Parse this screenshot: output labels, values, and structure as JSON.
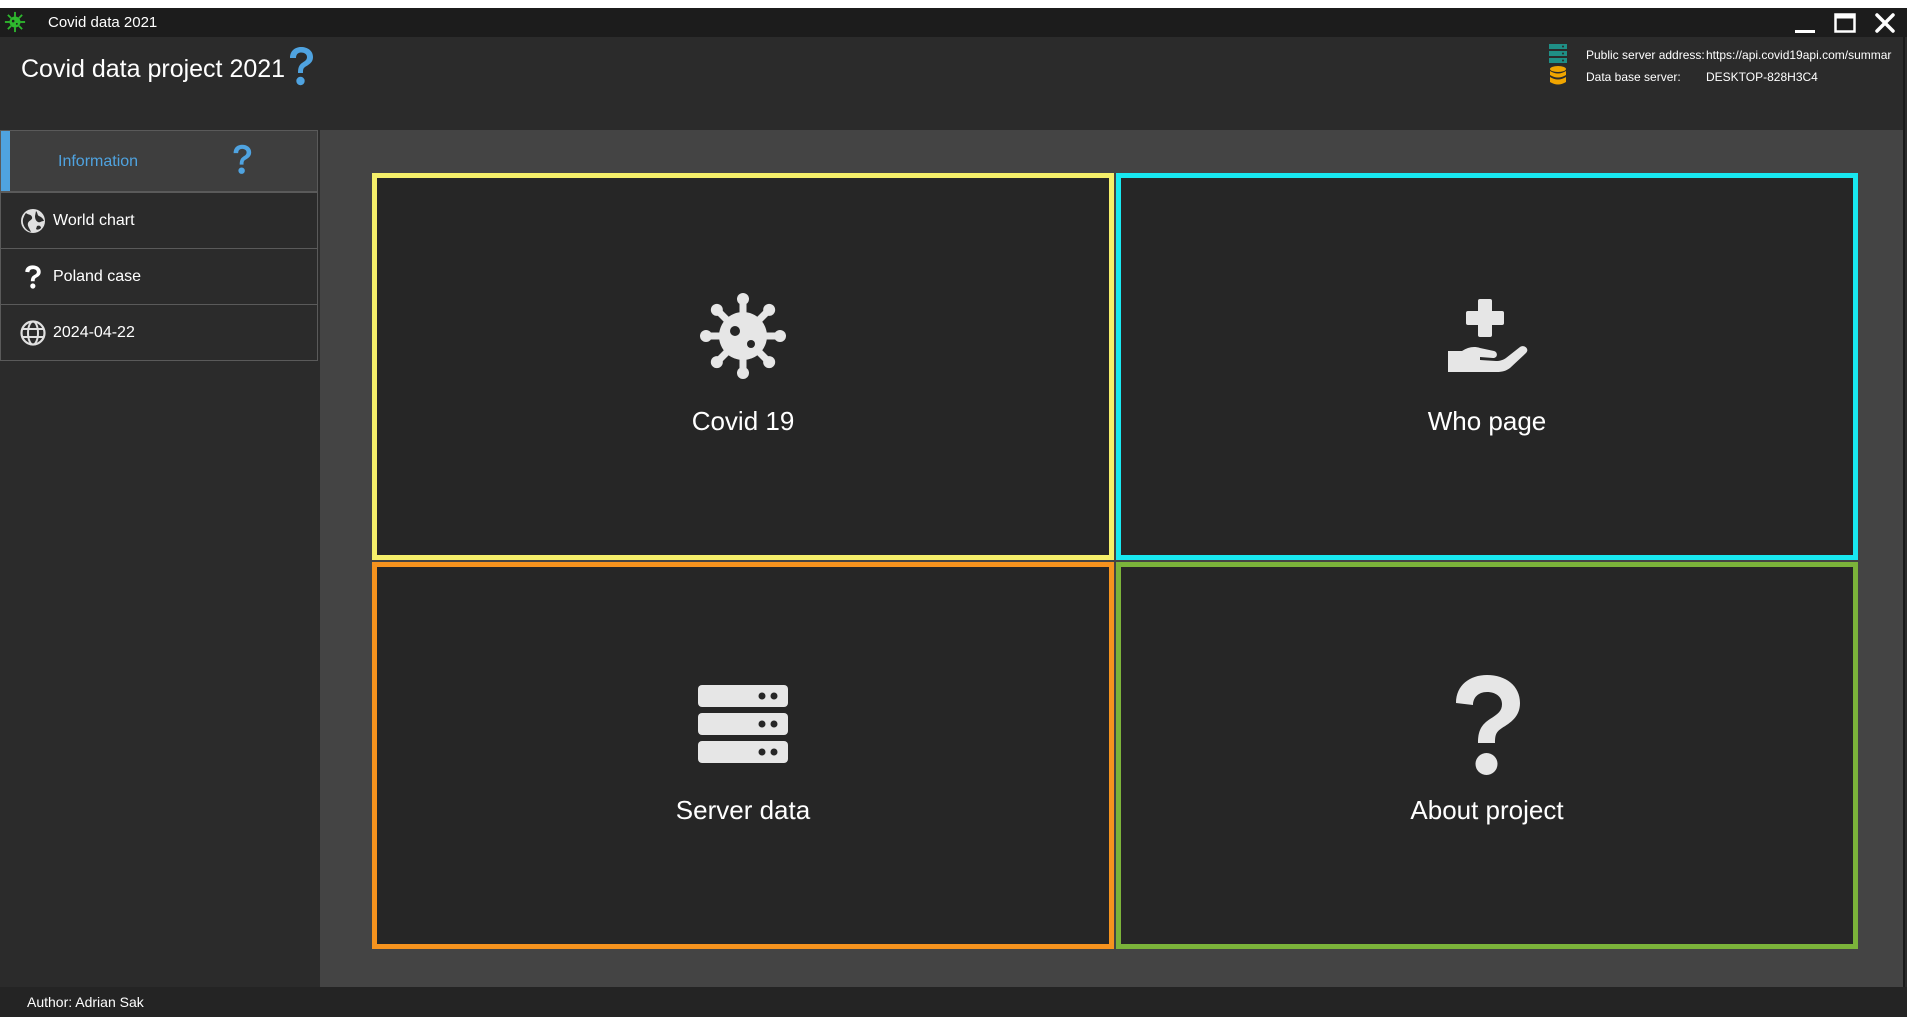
{
  "titlebar": {
    "title": "Covid data 2021",
    "app_icon": "virus-icon",
    "minimize": "minimize-icon",
    "maximize": "maximize-icon",
    "close": "close-icon"
  },
  "header": {
    "title": "Covid data project 2021",
    "help_icon": "question-icon",
    "public_server_label": "Public server address:",
    "public_server_value": "https://api.covid19api.com/summar",
    "db_server_label": "Data base server:",
    "db_server_value": "DESKTOP-828H3C4"
  },
  "sidebar": {
    "items": [
      {
        "label": "Information",
        "icon": "question-icon",
        "active": true
      },
      {
        "label": "World chart",
        "icon": "globe-americas-icon"
      },
      {
        "label": "Poland case",
        "icon": "question-icon"
      },
      {
        "label": "2024-04-22",
        "icon": "globe-icon"
      }
    ]
  },
  "tiles": [
    {
      "label": "Covid 19",
      "icon": "virus-icon",
      "color": "#f5ef6a"
    },
    {
      "label": "Who page",
      "icon": "hand-holding-medical-icon",
      "color": "#18e8f0"
    },
    {
      "label": "Server data",
      "icon": "server-icon",
      "color": "#f6931e"
    },
    {
      "label": "About project",
      "icon": "question-icon",
      "color": "#7bb33a"
    }
  ],
  "footer": {
    "author": "Author: Adrian Sak"
  },
  "colors": {
    "accent": "#4fa3e0",
    "background": "#2b2b2b",
    "panel": "#444444"
  }
}
